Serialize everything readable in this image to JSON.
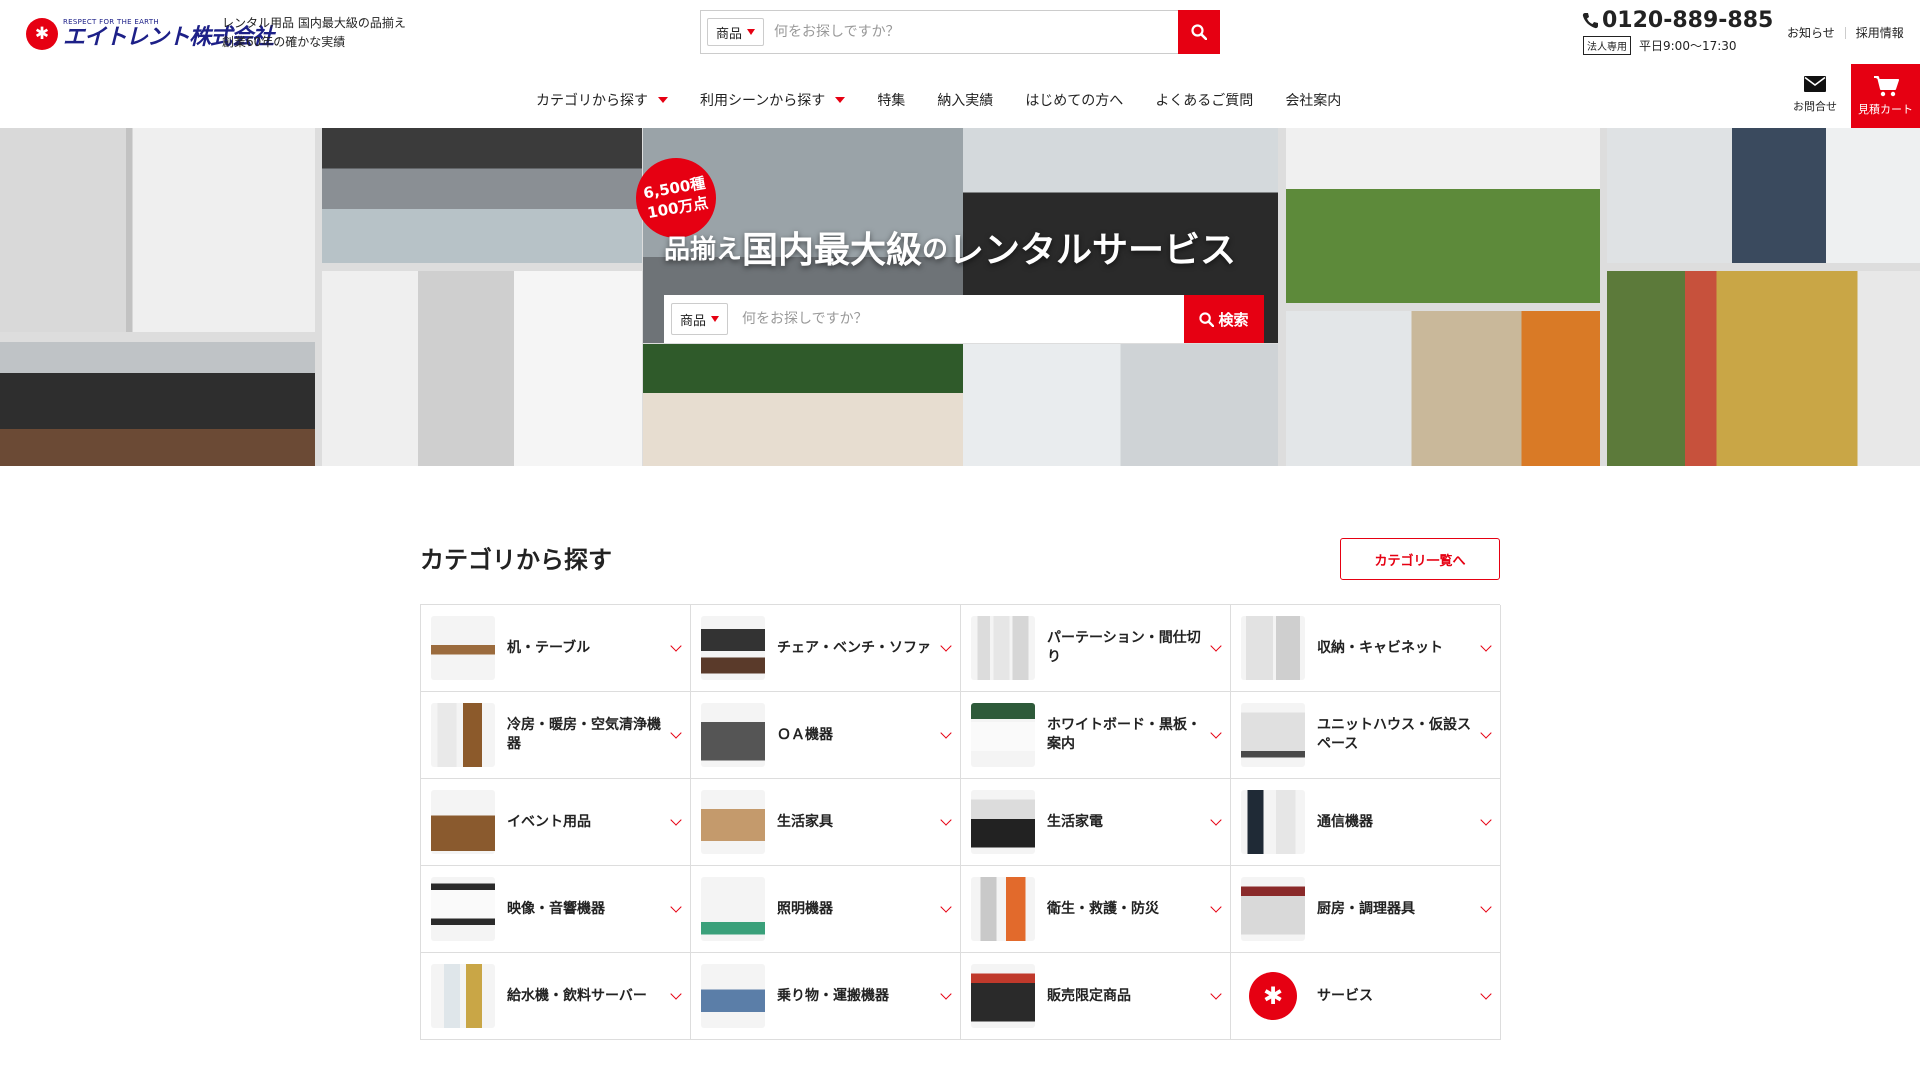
{
  "header": {
    "logo_tagline": "RESPECT FOR THE EARTH",
    "logo_name": "エイトレント株式会社",
    "tagline_1": "レンタル用品 国内最大級の品揃え",
    "tagline_2": "創業60年の確かな実績",
    "search": {
      "category": "商品",
      "placeholder": "何をお探しですか？"
    },
    "phone": "0120-889-885",
    "corp_badge": "法人専用",
    "hours": "平日9:00〜17:30",
    "links": [
      "お知らせ",
      "採用情報"
    ],
    "contact_label": "お問合せ",
    "cart_label": "見積カート"
  },
  "nav": [
    {
      "label": "カテゴリから探す",
      "dropdown": true
    },
    {
      "label": "利用シーンから探す",
      "dropdown": true
    },
    {
      "label": "特集",
      "dropdown": false
    },
    {
      "label": "納入実績",
      "dropdown": false
    },
    {
      "label": "はじめての方へ",
      "dropdown": false
    },
    {
      "label": "よくあるご質問",
      "dropdown": false
    },
    {
      "label": "会社案内",
      "dropdown": false
    }
  ],
  "hero": {
    "badge_line1": "6,500種",
    "badge_line2": "100万点",
    "title_part1": "品揃え",
    "title_part2": "国内最大級",
    "title_part3": "の",
    "title_part4": "レンタルサービス",
    "search": {
      "category": "商品",
      "placeholder": "何をお探しですか？",
      "button": "検索"
    }
  },
  "categories": {
    "title": "カテゴリから探す",
    "all_button": "カテゴリ一覧へ",
    "items": [
      {
        "label": "机・テーブル",
        "icon": "desk-table-icon"
      },
      {
        "label": "チェア・ベンチ・ソファ",
        "icon": "chair-sofa-icon"
      },
      {
        "label": "パーテーション・間仕切り",
        "icon": "partition-icon"
      },
      {
        "label": "収納・キャビネット",
        "icon": "cabinet-icon"
      },
      {
        "label": "冷房・暖房・空気清浄機器",
        "icon": "air-conditioner-icon"
      },
      {
        "label": "ＯＡ機器",
        "icon": "office-equipment-icon"
      },
      {
        "label": "ホワイトボード・黒板・案内",
        "icon": "whiteboard-icon"
      },
      {
        "label": "ユニットハウス・仮設スペース",
        "icon": "unit-house-icon"
      },
      {
        "label": "イベント用品",
        "icon": "event-goods-icon"
      },
      {
        "label": "生活家具",
        "icon": "furniture-icon"
      },
      {
        "label": "生活家電",
        "icon": "appliance-icon"
      },
      {
        "label": "通信機器",
        "icon": "communication-device-icon"
      },
      {
        "label": "映像・音響機器",
        "icon": "audio-visual-icon"
      },
      {
        "label": "照明機器",
        "icon": "lighting-icon"
      },
      {
        "label": "衛生・救護・防災",
        "icon": "first-aid-icon"
      },
      {
        "label": "厨房・調理器具",
        "icon": "kitchen-icon"
      },
      {
        "label": "給水機・飲料サーバー",
        "icon": "water-server-icon"
      },
      {
        "label": "乗り物・運搬機器",
        "icon": "vehicle-icon"
      },
      {
        "label": "販売限定商品",
        "icon": "limited-item-icon"
      },
      {
        "label": "サービス",
        "icon": "service-icon"
      }
    ]
  },
  "colors": {
    "accent": "#e60012",
    "brand_blue": "#1d2088",
    "border": "#dddddd"
  }
}
